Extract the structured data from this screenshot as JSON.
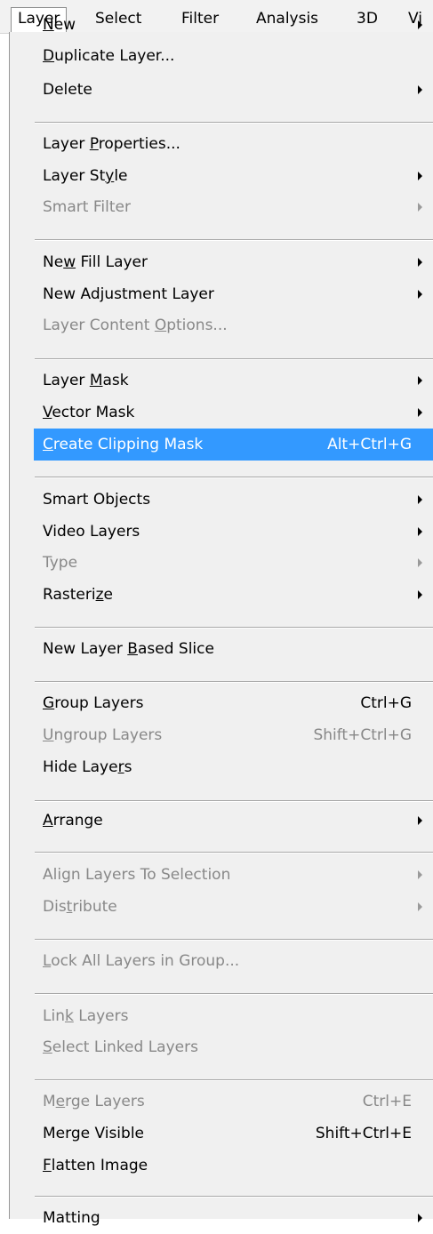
{
  "menubar": [
    {
      "label": "Layer",
      "open": true
    },
    {
      "label": "Select"
    },
    {
      "label": "Filter"
    },
    {
      "label": "Analysis"
    },
    {
      "label": "3D"
    },
    {
      "label": "Vi"
    }
  ],
  "menu": {
    "items": [
      {
        "pre": "",
        "u": "N",
        "post": "ew",
        "shortcut": "",
        "submenu": true,
        "enabled": true
      },
      {
        "pre": "",
        "u": "D",
        "post": "uplicate Layer...",
        "shortcut": "",
        "submenu": false,
        "enabled": true
      },
      {
        "pre": "Delete",
        "u": "",
        "post": "",
        "shortcut": "",
        "submenu": true,
        "enabled": true
      },
      {
        "pre": "Layer ",
        "u": "P",
        "post": "roperties...",
        "shortcut": "",
        "submenu": false,
        "enabled": true
      },
      {
        "pre": "Layer St",
        "u": "y",
        "post": "le",
        "shortcut": "",
        "submenu": true,
        "enabled": true
      },
      {
        "pre": "Smart Filter",
        "u": "",
        "post": "",
        "shortcut": "",
        "submenu": true,
        "enabled": false
      },
      {
        "pre": "Ne",
        "u": "w",
        "post": " Fill Layer",
        "shortcut": "",
        "submenu": true,
        "enabled": true
      },
      {
        "pre": "New Adjustment Layer",
        "u": "",
        "post": "",
        "shortcut": "",
        "submenu": true,
        "enabled": true
      },
      {
        "pre": "Layer Content ",
        "u": "O",
        "post": "ptions...",
        "shortcut": "",
        "submenu": false,
        "enabled": false
      },
      {
        "pre": "Layer ",
        "u": "M",
        "post": "ask",
        "shortcut": "",
        "submenu": true,
        "enabled": true
      },
      {
        "pre": "",
        "u": "V",
        "post": "ector Mask",
        "shortcut": "",
        "submenu": true,
        "enabled": true
      },
      {
        "pre": "",
        "u": "C",
        "post": "reate Clipping Mask",
        "shortcut": "Alt+Ctrl+G",
        "submenu": false,
        "enabled": true,
        "highlighted": true
      },
      {
        "pre": "Smart Objects",
        "u": "",
        "post": "",
        "shortcut": "",
        "submenu": true,
        "enabled": true
      },
      {
        "pre": "Video Layers",
        "u": "",
        "post": "",
        "shortcut": "",
        "submenu": true,
        "enabled": true
      },
      {
        "pre": "Type",
        "u": "",
        "post": "",
        "shortcut": "",
        "submenu": true,
        "enabled": false
      },
      {
        "pre": "Rasteri",
        "u": "z",
        "post": "e",
        "shortcut": "",
        "submenu": true,
        "enabled": true
      },
      {
        "pre": "New Layer ",
        "u": "B",
        "post": "ased Slice",
        "shortcut": "",
        "submenu": false,
        "enabled": true
      },
      {
        "pre": "",
        "u": "G",
        "post": "roup Layers",
        "shortcut": "Ctrl+G",
        "submenu": false,
        "enabled": true
      },
      {
        "pre": "",
        "u": "U",
        "post": "ngroup Layers",
        "shortcut": "Shift+Ctrl+G",
        "submenu": false,
        "enabled": false
      },
      {
        "pre": "Hide Laye",
        "u": "r",
        "post": "s",
        "shortcut": "",
        "submenu": false,
        "enabled": true
      },
      {
        "pre": "",
        "u": "A",
        "post": "rrange",
        "shortcut": "",
        "submenu": true,
        "enabled": true
      },
      {
        "pre": "Align Layers To Selection",
        "u": "",
        "post": "",
        "shortcut": "",
        "submenu": true,
        "enabled": false
      },
      {
        "pre": "Dis",
        "u": "t",
        "post": "ribute",
        "shortcut": "",
        "submenu": true,
        "enabled": false
      },
      {
        "pre": "",
        "u": "L",
        "post": "ock All Layers in Group...",
        "shortcut": "",
        "submenu": false,
        "enabled": false
      },
      {
        "pre": "Lin",
        "u": "k",
        "post": " Layers",
        "shortcut": "",
        "submenu": false,
        "enabled": false
      },
      {
        "pre": "",
        "u": "S",
        "post": "elect Linked Layers",
        "shortcut": "",
        "submenu": false,
        "enabled": false
      },
      {
        "pre": "M",
        "u": "e",
        "post": "rge Layers",
        "shortcut": "Ctrl+E",
        "submenu": false,
        "enabled": false
      },
      {
        "pre": "Merge Visible",
        "u": "",
        "post": "",
        "shortcut": "Shift+Ctrl+E",
        "submenu": false,
        "enabled": true
      },
      {
        "pre": "",
        "u": "F",
        "post": "latten Image",
        "shortcut": "",
        "submenu": false,
        "enabled": true
      },
      {
        "pre": "Matting",
        "u": "",
        "post": "",
        "shortcut": "",
        "submenu": true,
        "enabled": true
      }
    ]
  },
  "colors": {
    "highlight": "#3399ff",
    "disabled_text": "#888888",
    "menu_background": "#f0f0f0"
  }
}
